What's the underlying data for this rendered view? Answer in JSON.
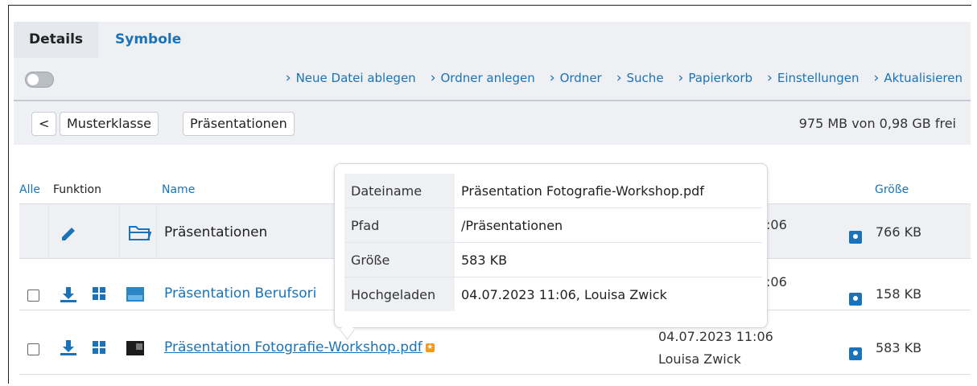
{
  "tabs": {
    "details": "Details",
    "symbols": "Symbole"
  },
  "toolbar": {
    "actions": [
      "Neue Datei ablegen",
      "Ordner anlegen",
      "Ordner",
      "Suche",
      "Papierkorb",
      "Einstellungen",
      "Aktualisieren"
    ]
  },
  "breadcrumb": {
    "back": "<",
    "items": [
      "Musterklasse",
      "Präsentationen"
    ]
  },
  "quota": "975 MB von 0,98 GB frei",
  "table": {
    "headers": {
      "all": "Alle",
      "function": "Funktion",
      "name": "Name",
      "size": "Größe"
    },
    "rows": [
      {
        "name": "Präsentationen",
        "date": ":06",
        "size": "766 KB"
      },
      {
        "name": "Präsentation Berufsori",
        "date": ":06",
        "size": "158 KB"
      },
      {
        "name": "Präsentation Fotografie-Workshop.pdf",
        "date": "04.07.2023 11:06",
        "user": "Louisa Zwick",
        "size": "583 KB"
      }
    ]
  },
  "tooltip": {
    "rows": [
      {
        "key": "Dateiname",
        "value": "Präsentation Fotografie-Workshop.pdf"
      },
      {
        "key": "Pfad",
        "value": "/Präsentationen"
      },
      {
        "key": "Größe",
        "value": "583 KB"
      },
      {
        "key": "Hochgeladen",
        "value": "04.07.2023 11:06, Louisa Zwick"
      }
    ]
  },
  "colors": {
    "link": "#1a73b8",
    "panel": "#eef0f3",
    "badge": "#f39c12"
  }
}
